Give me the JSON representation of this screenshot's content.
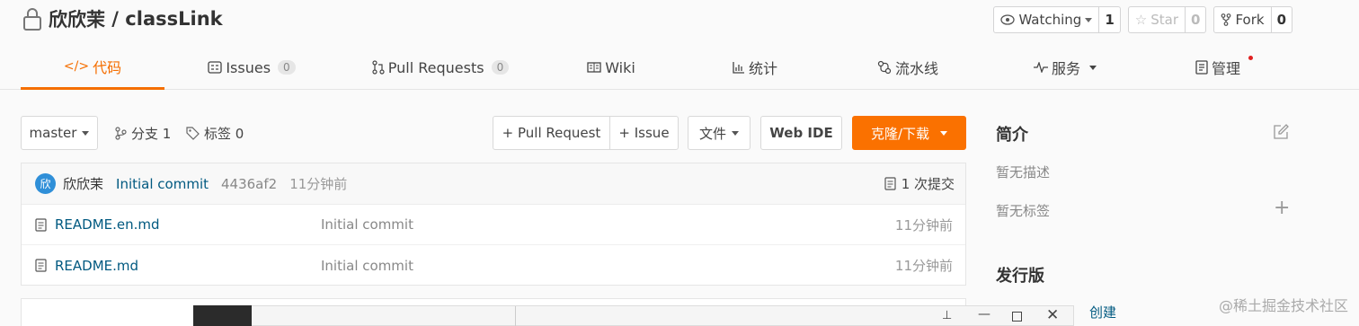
{
  "repo": {
    "owner": "欣欣茉",
    "name": "classLink",
    "separator": " / "
  },
  "actions": {
    "watch": {
      "label": "Watching",
      "count": "1"
    },
    "star": {
      "label": "Star",
      "count": "0"
    },
    "fork": {
      "label": "Fork",
      "count": "0"
    }
  },
  "tabs": [
    {
      "label": "代码",
      "icon": "code-icon"
    },
    {
      "label": "Issues",
      "badge": "0",
      "icon": "issues-icon"
    },
    {
      "label": "Pull Requests",
      "badge": "0",
      "icon": "pull-request-icon"
    },
    {
      "label": "Wiki",
      "icon": "wiki-icon"
    },
    {
      "label": "统计",
      "icon": "stats-icon"
    },
    {
      "label": "流水线",
      "icon": "pipeline-icon"
    },
    {
      "label": "服务",
      "icon": "service-icon"
    },
    {
      "label": "管理",
      "icon": "manage-icon"
    }
  ],
  "toolbar": {
    "branch": "master",
    "branches": "分支 1",
    "tags": "标签 0",
    "pull_request": "+ Pull Request",
    "issue": "+ Issue",
    "file": "文件",
    "web_ide": "Web IDE",
    "clone": "克隆/下载"
  },
  "commit": {
    "avatar_letter": "欣",
    "author": "欣欣茉",
    "message": "Initial commit",
    "hash": "4436af2",
    "time": "11分钟前",
    "count": "1 次提交"
  },
  "files": [
    {
      "name": "README.en.md",
      "message": "Initial commit",
      "time": "11分钟前"
    },
    {
      "name": "README.md",
      "message": "Initial commit",
      "time": "11分钟前"
    }
  ],
  "sidebar": {
    "intro_title": "简介",
    "no_desc": "暂无描述",
    "no_tags": "暂无标签",
    "release_title": "发行版",
    "create": "创建"
  },
  "watermark": "@稀土掘金技术社区",
  "colors": {
    "accent": "#f56e00",
    "clone_bg": "#fa7100",
    "link": "#005980"
  }
}
